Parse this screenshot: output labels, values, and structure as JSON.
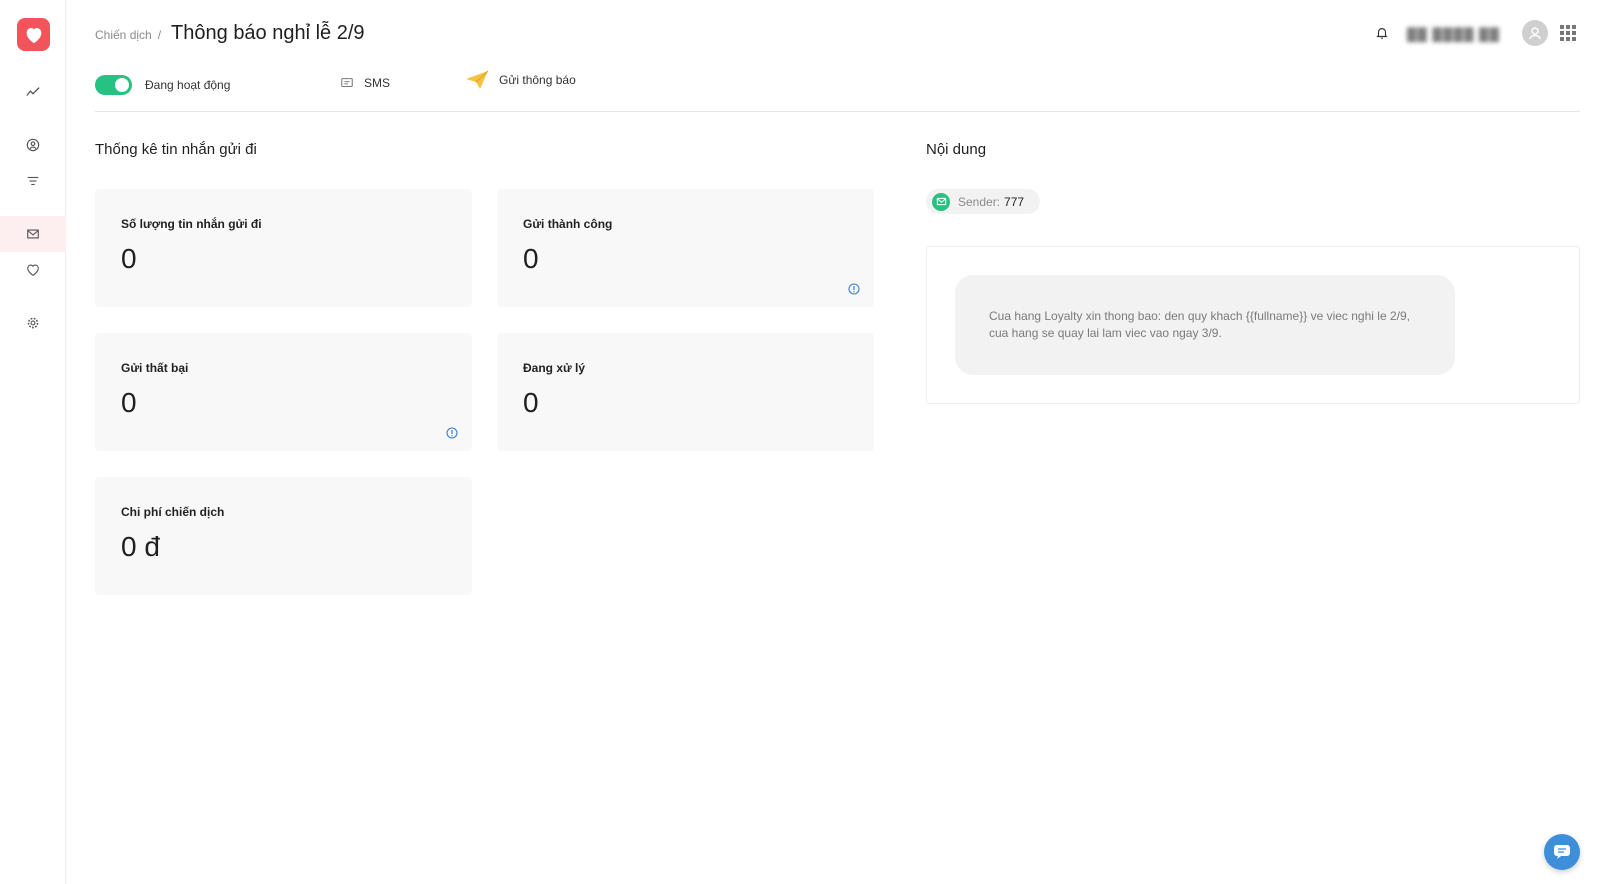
{
  "breadcrumb": {
    "parent": "Chiến dịch",
    "separator": "/",
    "title": "Thông báo nghỉ lễ 2/9"
  },
  "header": {
    "username": "▓▓ ▓▓▓▓ ▓▓"
  },
  "status": {
    "toggle_on": true,
    "toggle_label": "Đang hoạt động",
    "channel_label": "SMS",
    "notify_label": "Gửi thông báo"
  },
  "stats": {
    "title": "Thống kê tin nhắn gửi đi",
    "cards": [
      {
        "label": "Số lượng tin nhắn gửi đi",
        "value": "0"
      },
      {
        "label": "Gửi thành công",
        "value": "0"
      },
      {
        "label": "Gửi thất bại",
        "value": "0"
      },
      {
        "label": "Đang xử lý",
        "value": "0"
      },
      {
        "label": "Chi phí chiến dịch",
        "value": "0 đ"
      }
    ]
  },
  "content": {
    "title": "Nội dung",
    "sender_label": "Sender:",
    "sender_value": "777",
    "message": "Cua hang Loyalty xin thong bao: den quy khach {{fullname}} ve viec nghi le 2/9, cua hang se quay lai lam viec vao ngay 3/9."
  },
  "icons": {
    "logo": "heart-icon",
    "sidebar": [
      "trend-chart-icon",
      "user-circle-icon",
      "filter-icon",
      "mail-icon",
      "heart-outline-icon",
      "gear-icon"
    ],
    "header": [
      "bell-icon",
      "avatar-icon",
      "apps-grid-icon"
    ],
    "status": [
      "message-icon",
      "paper-plane-icon"
    ],
    "chat": "chat-bubble-icon"
  },
  "colors": {
    "brand": "#f2545b",
    "toggle": "#26c281",
    "info": "#3a7bd5",
    "chat": "#3e8ed9",
    "notify_icon": "#f5c242"
  }
}
